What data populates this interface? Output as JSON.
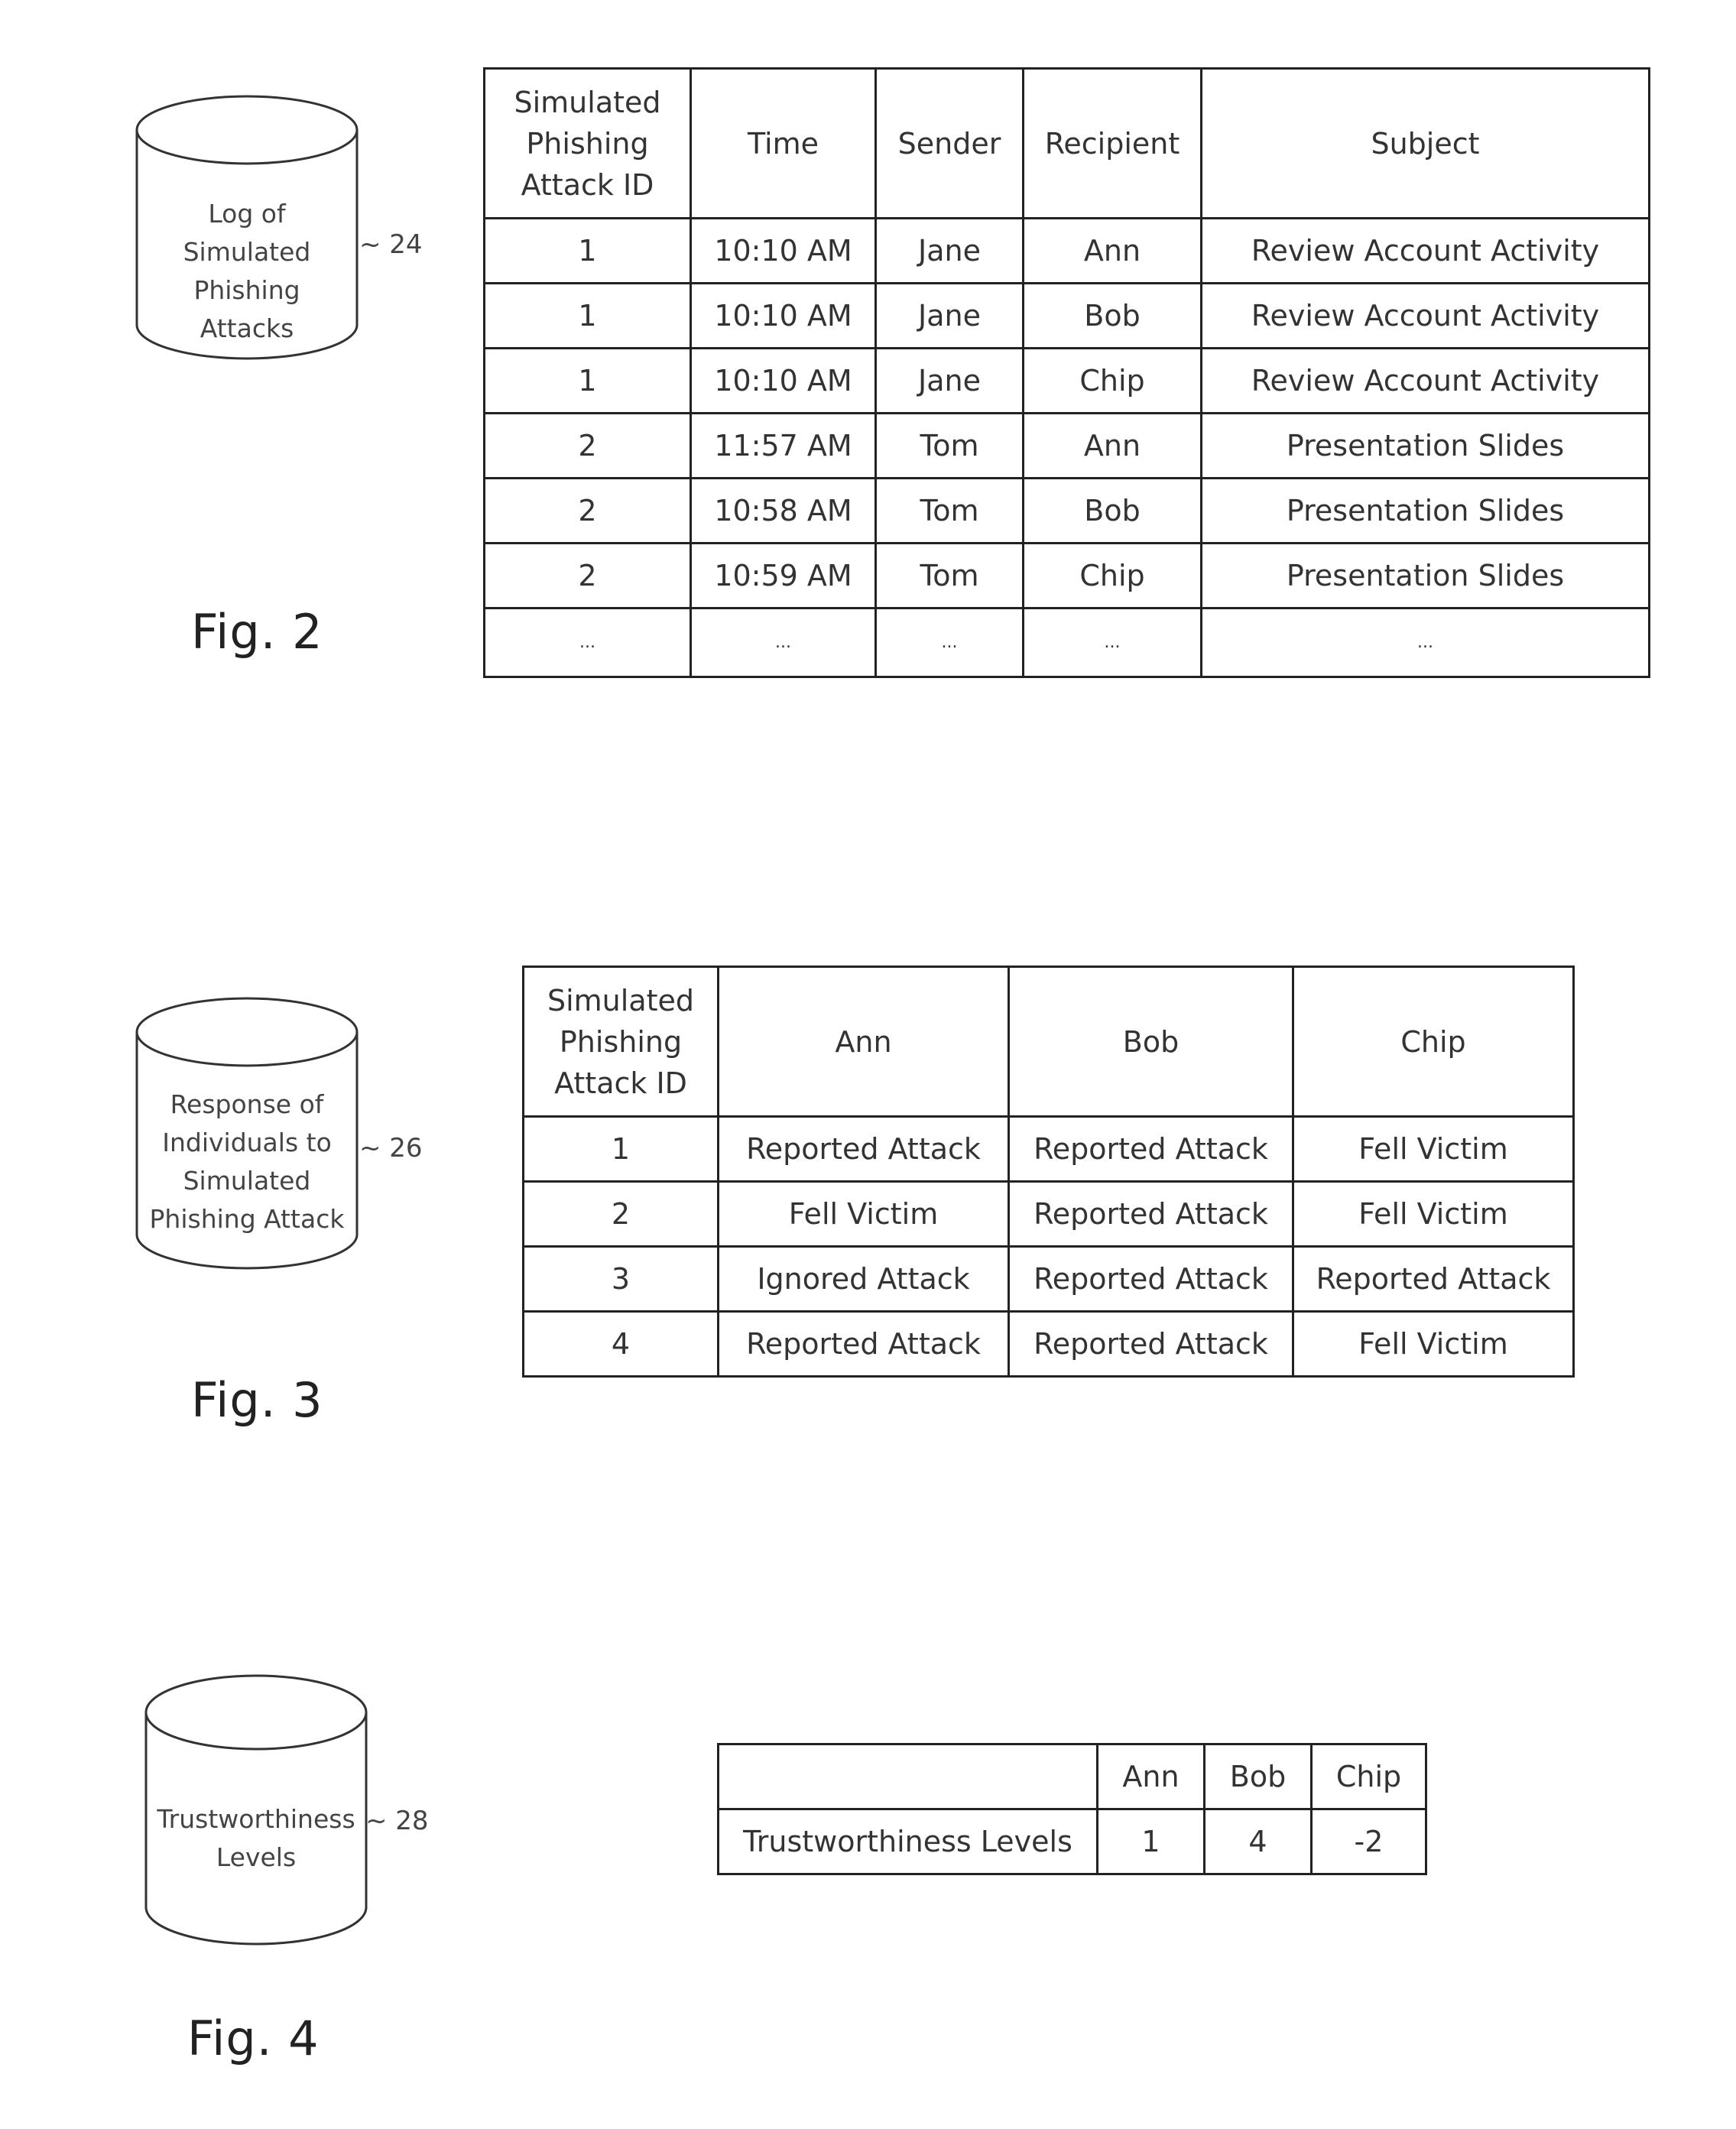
{
  "fig2": {
    "figure_label": "Fig. 2",
    "database": {
      "label_lines": [
        "Log of",
        "Simulated",
        "Phishing",
        "Attacks"
      ],
      "ref_numeral": "~ 24"
    },
    "table": {
      "headers": [
        "Simulated Phishing Attack ID",
        "Time",
        "Sender",
        "Recipient",
        "Subject"
      ],
      "rows": [
        [
          "1",
          "10:10 AM",
          "Jane",
          "Ann",
          "Review Account Activity"
        ],
        [
          "1",
          "10:10 AM",
          "Jane",
          "Bob",
          "Review Account Activity"
        ],
        [
          "1",
          "10:10 AM",
          "Jane",
          "Chip",
          "Review Account Activity"
        ],
        [
          "2",
          "11:57 AM",
          "Tom",
          "Ann",
          "Presentation Slides"
        ],
        [
          "2",
          "10:58 AM",
          "Tom",
          "Bob",
          "Presentation Slides"
        ],
        [
          "2",
          "10:59 AM",
          "Tom",
          "Chip",
          "Presentation Slides"
        ],
        [
          "...",
          "...",
          "...",
          "...",
          "..."
        ]
      ]
    }
  },
  "fig3": {
    "figure_label": "Fig. 3",
    "database": {
      "label_lines": [
        "Response of",
        "Individuals to",
        "Simulated",
        "Phishing Attack"
      ],
      "ref_numeral": "~ 26"
    },
    "table": {
      "headers": [
        "Simulated Phishing Attack ID",
        "Ann",
        "Bob",
        "Chip"
      ],
      "rows": [
        [
          "1",
          "Reported Attack",
          "Reported Attack",
          "Fell Victim"
        ],
        [
          "2",
          "Fell Victim",
          "Reported Attack",
          "Fell Victim"
        ],
        [
          "3",
          "Ignored Attack",
          "Reported Attack",
          "Reported Attack"
        ],
        [
          "4",
          "Reported Attack",
          "Reported Attack",
          "Fell Victim"
        ]
      ]
    }
  },
  "fig4": {
    "figure_label": "Fig. 4",
    "database": {
      "label_lines": [
        "Trustworthiness",
        "Levels"
      ],
      "ref_numeral": "~ 28"
    },
    "table": {
      "headers": [
        "",
        "Ann",
        "Bob",
        "Chip"
      ],
      "rows": [
        [
          "Trustworthiness Levels",
          "1",
          "4",
          "-2"
        ]
      ]
    }
  }
}
